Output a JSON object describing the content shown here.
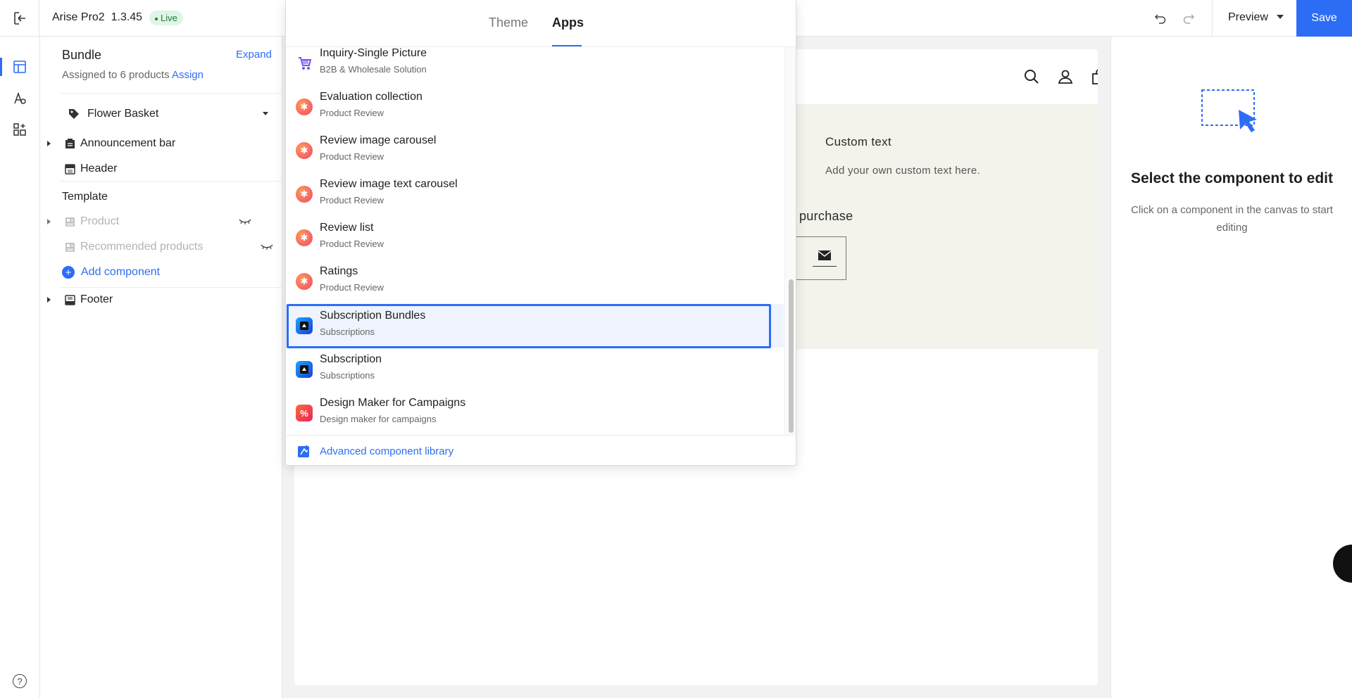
{
  "topbar": {
    "theme_name": "Arise Pro2",
    "version": "1.3.45",
    "status_badge": "Live",
    "preview_label": "Preview",
    "save_label": "Save"
  },
  "left_panel": {
    "title": "Bundle",
    "expand_label": "Expand",
    "assigned_text": "Assigned to 6 products",
    "assign_link": "Assign",
    "product_select": "Flower Basket",
    "sections": {
      "announcement_bar": "Announcement bar",
      "header": "Header",
      "template_label": "Template",
      "product": "Product",
      "recommended_products": "Recommended products",
      "add_component": "Add component",
      "footer": "Footer"
    }
  },
  "popover": {
    "tabs": [
      {
        "label": "Theme",
        "active": false
      },
      {
        "label": "Apps",
        "active": true
      }
    ],
    "apps": [
      {
        "name": "Inquiry-Single Picture",
        "category": "B2B & Wholesale Solution",
        "icon": "inquiry-icon"
      },
      {
        "name": "Evaluation collection",
        "category": "Product Review",
        "icon": "review-app-icon"
      },
      {
        "name": "Review image carousel",
        "category": "Product Review",
        "icon": "review-app-icon"
      },
      {
        "name": "Review image text carousel",
        "category": "Product Review",
        "icon": "review-app-icon"
      },
      {
        "name": "Review list",
        "category": "Product Review",
        "icon": "review-app-icon"
      },
      {
        "name": "Ratings",
        "category": "Product Review",
        "icon": "review-app-icon"
      },
      {
        "name": "Subscription Bundles",
        "category": "Subscriptions",
        "icon": "subscription-app-icon",
        "selected": true
      },
      {
        "name": "Subscription",
        "category": "Subscriptions",
        "icon": "subscription-app-icon"
      },
      {
        "name": "Design Maker for Campaigns",
        "category": "Design maker for campaigns",
        "icon": "design-maker-icon"
      }
    ],
    "footer_link": "Advanced component library"
  },
  "canvas": {
    "custom_text_title": "Custom text",
    "custom_text_body": "Add your own custom text here.",
    "purchase_text": "purchase"
  },
  "right_panel": {
    "title": "Select the component to edit",
    "description": "Click on a component in the canvas to start editing"
  },
  "colors": {
    "accent": "#2d6df6",
    "live_badge_bg": "#dff5e6",
    "live_badge_text": "#1f7a3e",
    "canvas_section_bg": "#f3f3ec"
  }
}
